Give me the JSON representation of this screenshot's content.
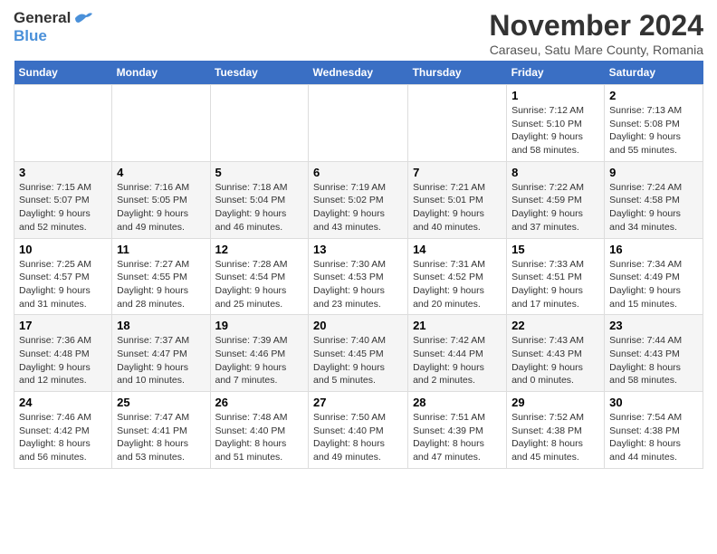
{
  "header": {
    "logo_general": "General",
    "logo_blue": "Blue",
    "month_title": "November 2024",
    "location": "Caraseu, Satu Mare County, Romania"
  },
  "days_of_week": [
    "Sunday",
    "Monday",
    "Tuesday",
    "Wednesday",
    "Thursday",
    "Friday",
    "Saturday"
  ],
  "weeks": [
    {
      "days": [
        {
          "number": "",
          "info": ""
        },
        {
          "number": "",
          "info": ""
        },
        {
          "number": "",
          "info": ""
        },
        {
          "number": "",
          "info": ""
        },
        {
          "number": "",
          "info": ""
        },
        {
          "number": "1",
          "info": "Sunrise: 7:12 AM\nSunset: 5:10 PM\nDaylight: 9 hours and 58 minutes."
        },
        {
          "number": "2",
          "info": "Sunrise: 7:13 AM\nSunset: 5:08 PM\nDaylight: 9 hours and 55 minutes."
        }
      ]
    },
    {
      "days": [
        {
          "number": "3",
          "info": "Sunrise: 7:15 AM\nSunset: 5:07 PM\nDaylight: 9 hours and 52 minutes."
        },
        {
          "number": "4",
          "info": "Sunrise: 7:16 AM\nSunset: 5:05 PM\nDaylight: 9 hours and 49 minutes."
        },
        {
          "number": "5",
          "info": "Sunrise: 7:18 AM\nSunset: 5:04 PM\nDaylight: 9 hours and 46 minutes."
        },
        {
          "number": "6",
          "info": "Sunrise: 7:19 AM\nSunset: 5:02 PM\nDaylight: 9 hours and 43 minutes."
        },
        {
          "number": "7",
          "info": "Sunrise: 7:21 AM\nSunset: 5:01 PM\nDaylight: 9 hours and 40 minutes."
        },
        {
          "number": "8",
          "info": "Sunrise: 7:22 AM\nSunset: 4:59 PM\nDaylight: 9 hours and 37 minutes."
        },
        {
          "number": "9",
          "info": "Sunrise: 7:24 AM\nSunset: 4:58 PM\nDaylight: 9 hours and 34 minutes."
        }
      ]
    },
    {
      "days": [
        {
          "number": "10",
          "info": "Sunrise: 7:25 AM\nSunset: 4:57 PM\nDaylight: 9 hours and 31 minutes."
        },
        {
          "number": "11",
          "info": "Sunrise: 7:27 AM\nSunset: 4:55 PM\nDaylight: 9 hours and 28 minutes."
        },
        {
          "number": "12",
          "info": "Sunrise: 7:28 AM\nSunset: 4:54 PM\nDaylight: 9 hours and 25 minutes."
        },
        {
          "number": "13",
          "info": "Sunrise: 7:30 AM\nSunset: 4:53 PM\nDaylight: 9 hours and 23 minutes."
        },
        {
          "number": "14",
          "info": "Sunrise: 7:31 AM\nSunset: 4:52 PM\nDaylight: 9 hours and 20 minutes."
        },
        {
          "number": "15",
          "info": "Sunrise: 7:33 AM\nSunset: 4:51 PM\nDaylight: 9 hours and 17 minutes."
        },
        {
          "number": "16",
          "info": "Sunrise: 7:34 AM\nSunset: 4:49 PM\nDaylight: 9 hours and 15 minutes."
        }
      ]
    },
    {
      "days": [
        {
          "number": "17",
          "info": "Sunrise: 7:36 AM\nSunset: 4:48 PM\nDaylight: 9 hours and 12 minutes."
        },
        {
          "number": "18",
          "info": "Sunrise: 7:37 AM\nSunset: 4:47 PM\nDaylight: 9 hours and 10 minutes."
        },
        {
          "number": "19",
          "info": "Sunrise: 7:39 AM\nSunset: 4:46 PM\nDaylight: 9 hours and 7 minutes."
        },
        {
          "number": "20",
          "info": "Sunrise: 7:40 AM\nSunset: 4:45 PM\nDaylight: 9 hours and 5 minutes."
        },
        {
          "number": "21",
          "info": "Sunrise: 7:42 AM\nSunset: 4:44 PM\nDaylight: 9 hours and 2 minutes."
        },
        {
          "number": "22",
          "info": "Sunrise: 7:43 AM\nSunset: 4:43 PM\nDaylight: 9 hours and 0 minutes."
        },
        {
          "number": "23",
          "info": "Sunrise: 7:44 AM\nSunset: 4:43 PM\nDaylight: 8 hours and 58 minutes."
        }
      ]
    },
    {
      "days": [
        {
          "number": "24",
          "info": "Sunrise: 7:46 AM\nSunset: 4:42 PM\nDaylight: 8 hours and 56 minutes."
        },
        {
          "number": "25",
          "info": "Sunrise: 7:47 AM\nSunset: 4:41 PM\nDaylight: 8 hours and 53 minutes."
        },
        {
          "number": "26",
          "info": "Sunrise: 7:48 AM\nSunset: 4:40 PM\nDaylight: 8 hours and 51 minutes."
        },
        {
          "number": "27",
          "info": "Sunrise: 7:50 AM\nSunset: 4:40 PM\nDaylight: 8 hours and 49 minutes."
        },
        {
          "number": "28",
          "info": "Sunrise: 7:51 AM\nSunset: 4:39 PM\nDaylight: 8 hours and 47 minutes."
        },
        {
          "number": "29",
          "info": "Sunrise: 7:52 AM\nSunset: 4:38 PM\nDaylight: 8 hours and 45 minutes."
        },
        {
          "number": "30",
          "info": "Sunrise: 7:54 AM\nSunset: 4:38 PM\nDaylight: 8 hours and 44 minutes."
        }
      ]
    }
  ]
}
